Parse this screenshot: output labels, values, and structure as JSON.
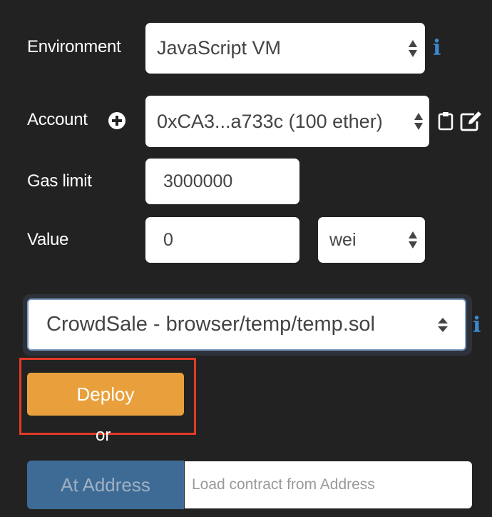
{
  "environment": {
    "label": "Environment",
    "selected": "JavaScript VM",
    "info_icon": "info-icon"
  },
  "account": {
    "label": "Account",
    "add_icon": "plus-circle-icon",
    "selected": "0xCA3...a733c (100 ether)",
    "copy_icon": "clipboard-icon",
    "edit_icon": "edit-icon"
  },
  "gas_limit": {
    "label": "Gas limit",
    "value": "3000000"
  },
  "value": {
    "label": "Value",
    "amount": "0",
    "unit": "wei"
  },
  "contract": {
    "selected": "CrowdSale - browser/temp/temp.sol",
    "info_icon": "info-icon"
  },
  "actions": {
    "deploy_label": "Deploy",
    "or_label": "or",
    "at_address_label": "At Address",
    "address_placeholder": "Load contract from Address"
  },
  "colors": {
    "background": "#222222",
    "deploy": "#e9a03c",
    "at_address": "#3e6b96",
    "info": "#3a8bd0",
    "highlight": "#e23a27"
  }
}
